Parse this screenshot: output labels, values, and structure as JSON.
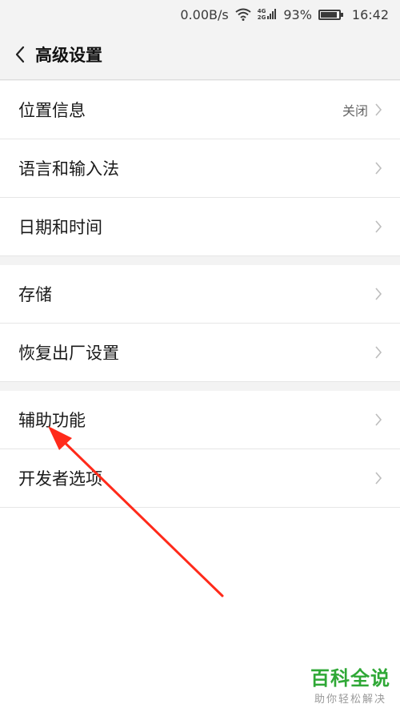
{
  "status_bar": {
    "net_speed": "0.00B/s",
    "net_type_top": "4G",
    "net_type_bottom": "2G",
    "battery_percent": "93%",
    "battery_level": 0.93,
    "time": "16:42"
  },
  "header": {
    "back_icon": "chevron-left-icon",
    "title": "高级设置"
  },
  "groups": [
    {
      "items": [
        {
          "label": "位置信息",
          "value": "关闭"
        },
        {
          "label": "语言和输入法"
        },
        {
          "label": "日期和时间"
        }
      ]
    },
    {
      "items": [
        {
          "label": "存储"
        },
        {
          "label": "恢复出厂设置"
        }
      ]
    },
    {
      "items": [
        {
          "label": "辅助功能"
        },
        {
          "label": "开发者选项"
        }
      ]
    }
  ],
  "watermark": {
    "brand": "百科全说",
    "slogan": "助你轻松解决"
  },
  "colors": {
    "annotation_arrow": "#ff2a1a",
    "watermark_green": "#2fa836"
  }
}
